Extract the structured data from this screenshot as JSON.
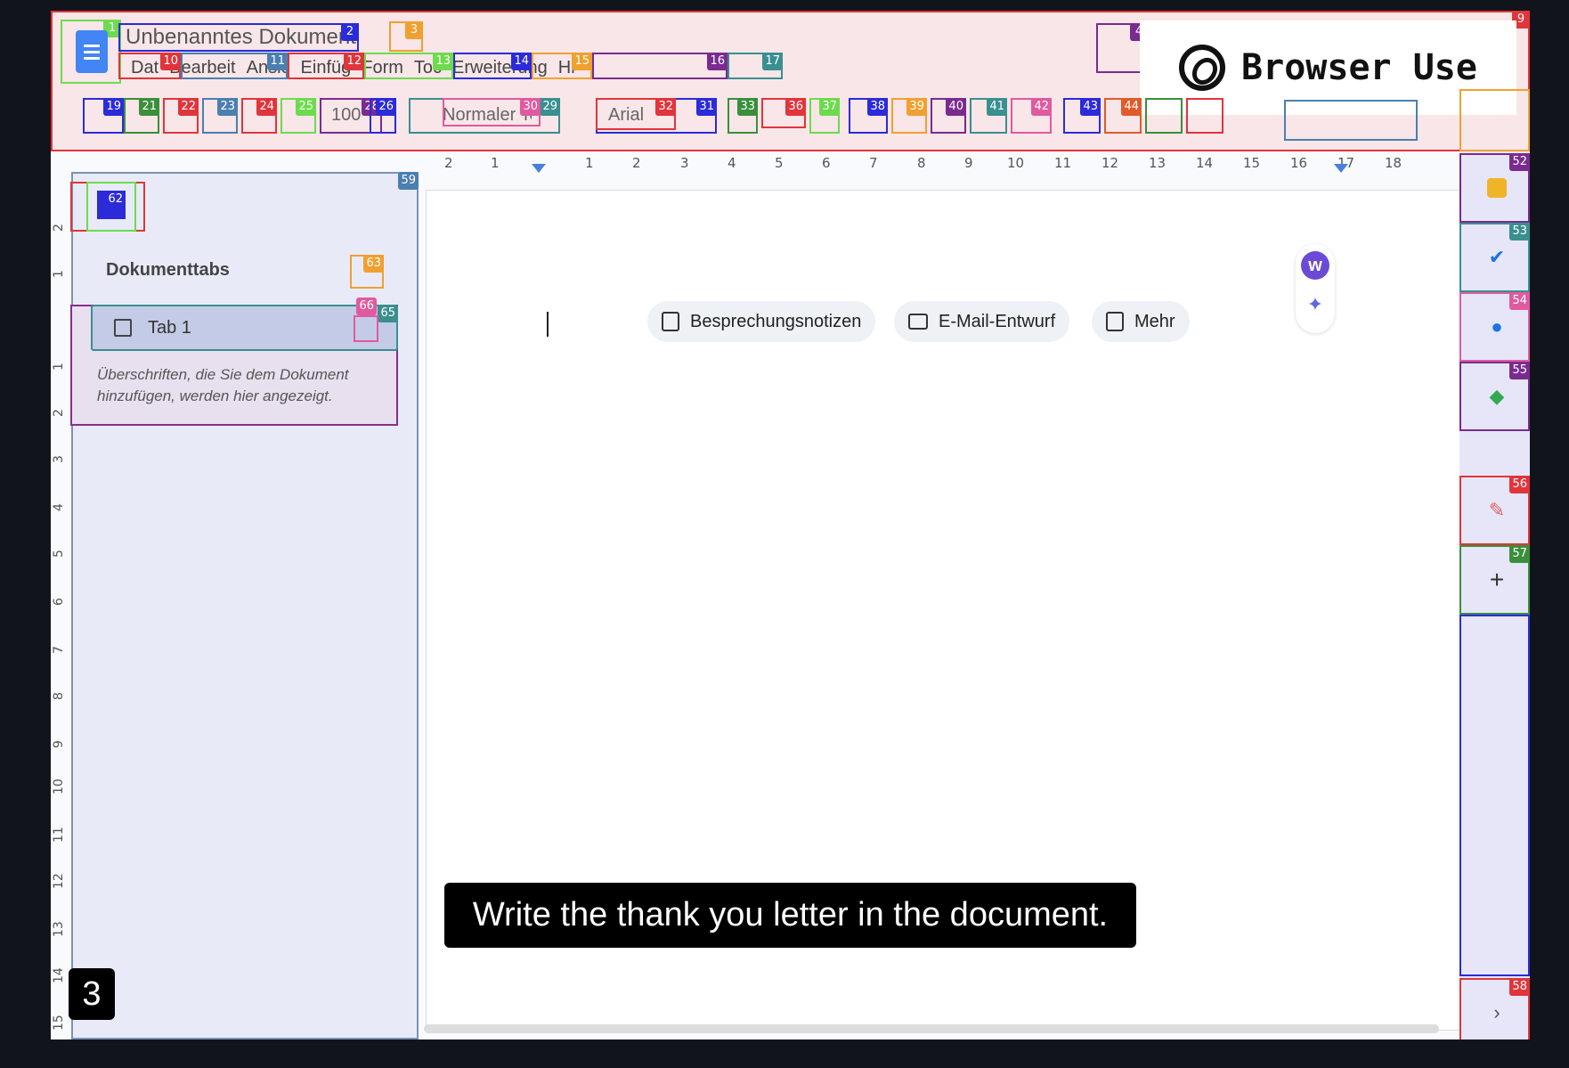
{
  "document": {
    "title": "Unbenanntes Dokument",
    "menu": [
      "Datei",
      "Bearbeiten",
      "Ansicht",
      "Einfügen",
      "Format",
      "Tools",
      "Erweiterungen",
      "Hilfe"
    ],
    "zoom": "100",
    "style_select": "Normaler Text",
    "font_select": "Arial"
  },
  "menu_display": [
    "Dat",
    "Bearbeit",
    "Ansic",
    "Einfüg",
    "Form",
    "Toc",
    "Erweiterung",
    "Hi"
  ],
  "brand": "Browser Use",
  "ruler": [
    "2",
    "1",
    "1",
    "2",
    "3",
    "4",
    "5",
    "6",
    "7",
    "8",
    "9",
    "10",
    "11",
    "12",
    "13",
    "14",
    "15",
    "16",
    "17",
    "18"
  ],
  "vruler": [
    "2",
    "1",
    "1",
    "2",
    "3",
    "4",
    "5",
    "6",
    "7",
    "8",
    "9",
    "10",
    "11",
    "12",
    "13",
    "14",
    "15"
  ],
  "sidebar": {
    "heading": "Dokumenttabs",
    "tab_label": "Tab 1",
    "hint": "Überschriften, die Sie dem Dokument hinzufügen, werden hier angezeigt."
  },
  "chips": [
    "Besprechungsnotizen",
    "E-Mail-Entwurf",
    "Mehr"
  ],
  "caption": "Write the thank you letter in the document.",
  "step": "3",
  "overlay_colors": {
    "red": "#e0353a",
    "blue": "#2b2bd9",
    "green": "#3a8f3a",
    "orange": "#f0a030",
    "purple": "#7a2b8f",
    "teal": "#3a8f8f",
    "pink": "#e05aa0",
    "lime": "#6ddb4d",
    "steel": "#4a7fb0"
  },
  "labels": [
    "1",
    "2",
    "3",
    "4",
    "9",
    "10",
    "11",
    "12",
    "13",
    "14",
    "15",
    "16",
    "17",
    "19",
    "21",
    "22",
    "23",
    "24",
    "25",
    "26",
    "28",
    "29",
    "30",
    "31",
    "32",
    "33",
    "36",
    "37",
    "38",
    "39",
    "40",
    "41",
    "42",
    "43",
    "44",
    "52",
    "53",
    "54",
    "55",
    "56",
    "57",
    "58",
    "59",
    "62",
    "63",
    "65",
    "66"
  ]
}
